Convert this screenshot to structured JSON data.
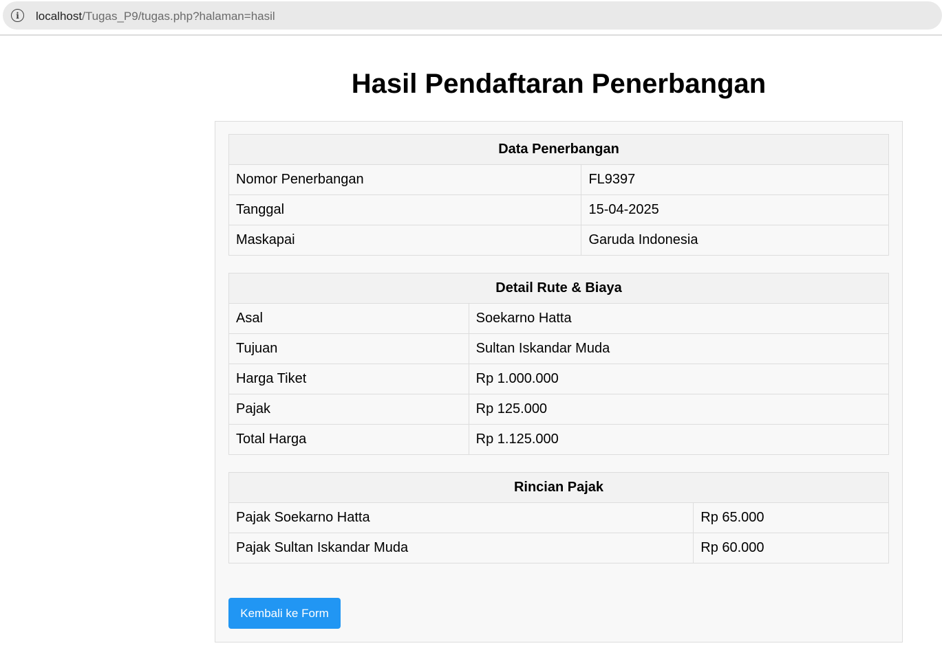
{
  "browser": {
    "url_host": "localhost",
    "url_path": "/Tugas_P9/tugas.php?halaman=hasil",
    "info_icon": "i"
  },
  "page": {
    "title": "Hasil Pendaftaran Penerbangan"
  },
  "data_penerbangan": {
    "heading": "Data Penerbangan",
    "rows": [
      {
        "label": "Nomor Penerbangan",
        "value": "FL9397"
      },
      {
        "label": "Tanggal",
        "value": "15-04-2025"
      },
      {
        "label": "Maskapai",
        "value": "Garuda Indonesia"
      }
    ]
  },
  "detail_rute": {
    "heading": "Detail Rute & Biaya",
    "rows": [
      {
        "label": "Asal",
        "value": "Soekarno Hatta"
      },
      {
        "label": "Tujuan",
        "value": "Sultan Iskandar Muda"
      },
      {
        "label": "Harga Tiket",
        "value": "Rp 1.000.000"
      },
      {
        "label": "Pajak",
        "value": "Rp 125.000"
      },
      {
        "label": "Total Harga",
        "value": "Rp 1.125.000"
      }
    ]
  },
  "rincian_pajak": {
    "heading": "Rincian Pajak",
    "rows": [
      {
        "label": "Pajak Soekarno Hatta",
        "value": "Rp 65.000"
      },
      {
        "label": "Pajak Sultan Iskandar Muda",
        "value": "Rp 60.000"
      }
    ]
  },
  "actions": {
    "back_label": "Kembali ke Form"
  },
  "colors": {
    "button": "#2196f3",
    "header_bg": "#f2f2f2",
    "container_bg": "#f8f8f8",
    "border": "#dddddd"
  }
}
